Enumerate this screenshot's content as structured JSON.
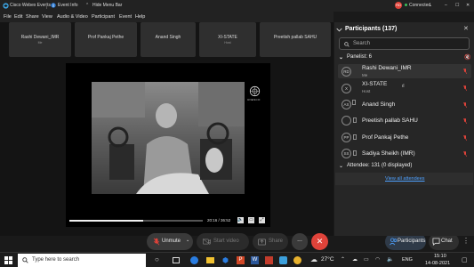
{
  "titlebar": {
    "app": "Cisco Webex Events",
    "event_info": "Event Info",
    "hide_menu": "Hide Menu Bar",
    "status": "Connected"
  },
  "menu": [
    "File",
    "Edit",
    "Share",
    "View",
    "Audio & Video",
    "Participant",
    "Event",
    "Help"
  ],
  "thumbnails": [
    {
      "name": "Rashi Dewani_IMR",
      "role": "Me"
    },
    {
      "name": "Prof Pankaj Pethe",
      "role": ""
    },
    {
      "name": "Anand Singh",
      "role": ""
    },
    {
      "name": "XI-STATE",
      "role": "Host"
    },
    {
      "name": "Preetish pallab SAHU",
      "role": ""
    }
  ],
  "video": {
    "time": "20:16 / 36:52",
    "progress": 0.55,
    "watermark": "UNESCO"
  },
  "controls": {
    "unmute": "Unmute",
    "start_video": "Start video",
    "share": "Share",
    "more": "...",
    "participants": "Participants",
    "chat": "Chat"
  },
  "panel": {
    "title": "Participants (137)",
    "search_placeholder": "Search",
    "panelist_header": "Panelist: 6",
    "panelists": [
      {
        "initials": "RD",
        "name": "Rashi Dewani_IMR",
        "role": "Me"
      },
      {
        "initials": "X",
        "name": "XI-STATE",
        "role": "Host"
      },
      {
        "initials": "AS",
        "name": "Anand Singh",
        "role": ""
      },
      {
        "initials": "",
        "name": "Preetish pallab SAHU",
        "role": ""
      },
      {
        "initials": "PP",
        "name": "Prof Pankaj Pethe",
        "role": ""
      },
      {
        "initials": "SS",
        "name": "Sadiya Sheikh (IMR)",
        "role": ""
      }
    ],
    "attendee_header": "Attendee: 131 (0 displayed)",
    "view_all": "View all attendees"
  },
  "taskbar": {
    "search_placeholder": "Type here to search",
    "temperature": "27°C",
    "language": "ENG",
    "time": "15:10",
    "date": "14-08-2021"
  },
  "colors": {
    "accent_green": "#2b8a3e",
    "danger_red": "#e0433a",
    "link_blue": "#4ea1ff"
  }
}
